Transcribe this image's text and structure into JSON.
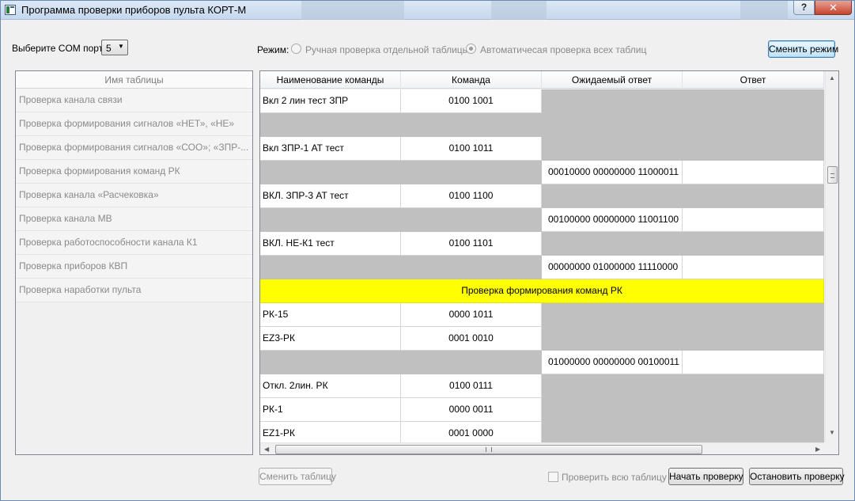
{
  "window": {
    "title": "Программа проверки приборов пульта КОРТ-М",
    "help_label": "?",
    "close_label": "✕"
  },
  "com": {
    "label": "Выберите COM порт:",
    "value": "5"
  },
  "mode": {
    "label": "Режим:",
    "options": [
      {
        "label": "Ручная проверка отдельной таблицы",
        "checked": false
      },
      {
        "label": "Автоматичесая проверка всех таблиц",
        "checked": true
      }
    ],
    "change_button": "Сменить режим"
  },
  "tables": {
    "header": "Имя таблицы",
    "items": [
      "Проверка канала связи",
      "Проверка формирования сигналов «НЕТ», «НЕ»",
      "Проверка формирования сигналов «СОО»; «ЗПР-...",
      "Проверка формирования команд РК",
      "Проверка канала «Расчековка»",
      "Проверка канала МВ",
      "Проверка работоспособности канала К1",
      "Проверка приборов КВП",
      "Проверка наработки пульта"
    ]
  },
  "grid": {
    "columns": [
      "Наименование команды",
      "Команда",
      "Ожидаемый ответ",
      "Ответ"
    ],
    "rows": [
      {
        "kind": "cmd",
        "name": "Вкл 2 лин тест ЗПР",
        "code": "0100 1001"
      },
      {
        "kind": "blank"
      },
      {
        "kind": "cmd",
        "name": "Вкл ЗПР-1 АТ тест",
        "code": "0100 1011"
      },
      {
        "kind": "resp",
        "expected": "00010000  00000000  11000011"
      },
      {
        "kind": "cmd",
        "name": "ВКЛ. ЗПР-3 АТ тест",
        "code": "0100 1100"
      },
      {
        "kind": "resp",
        "expected": "00100000  00000000  11001100"
      },
      {
        "kind": "cmd",
        "name": "ВКЛ. НЕ-К1 тест",
        "code": "0100 1101"
      },
      {
        "kind": "resp",
        "expected": "00000000  01000000  11110000"
      },
      {
        "kind": "section",
        "title": "Проверка формирования команд РК"
      },
      {
        "kind": "cmd",
        "name": "РК-15",
        "code": "0000 1011"
      },
      {
        "kind": "cmd",
        "name": "EZ3-РК",
        "code": "0001 0010"
      },
      {
        "kind": "resp",
        "expected": "01000000  00000000  00100011"
      },
      {
        "kind": "cmd",
        "name": "Откл. 2лин. РК",
        "code": "0100 0111"
      },
      {
        "kind": "cmd",
        "name": "РК-1",
        "code": "0000 0011"
      },
      {
        "kind": "cmd",
        "name": "EZ1-РК",
        "code": "0001 0000"
      }
    ],
    "scroll_h_grip": "III"
  },
  "bottom": {
    "change_table_button": "Сменить таблицу",
    "check_all_label": "Проверить всю таблицу",
    "start_button": "Начать проверку",
    "stop_button": "Остановить проверку"
  },
  "colors": {
    "highlight": "#ffff00",
    "cell_grey": "#c0c0c0",
    "title_bar": "#c6d8ee",
    "close_red": "#c6452d"
  }
}
